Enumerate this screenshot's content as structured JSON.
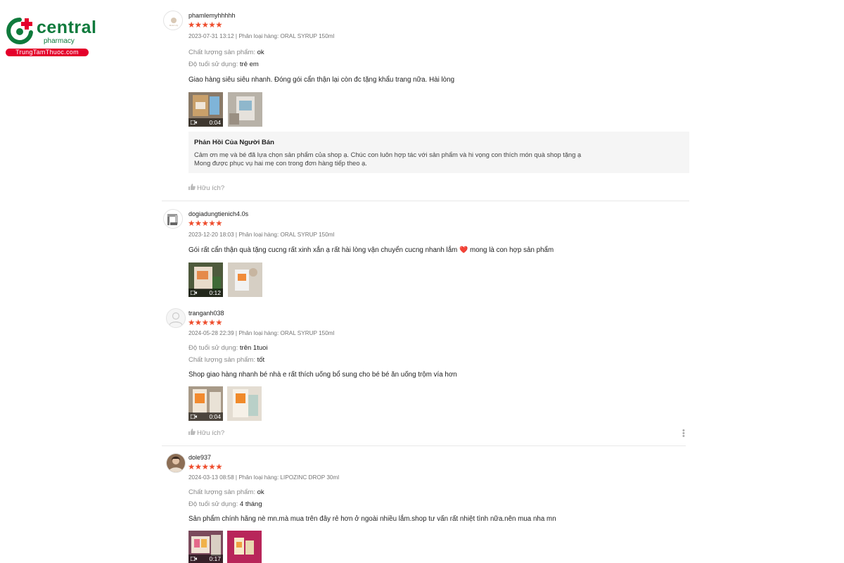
{
  "brand": {
    "name": "central",
    "sub": "pharmacy",
    "site": "TrungTamThuoc.com",
    "colors": {
      "green": "#0f7a3c",
      "red": "#e4002b"
    }
  },
  "stars_glyph": "★★★★★",
  "reviews": [
    {
      "username": "phamlemyhhhhh",
      "rating": 5,
      "meta": "2023-07-31 13:12 | Phân loại hàng: ORAL SYRUP 150ml",
      "attributes": [
        {
          "key": "Chất lượng sản phẩm:",
          "value": "ok"
        },
        {
          "key": "Độ tuổi sử dụng:",
          "value": "trẻ em"
        }
      ],
      "text": "Giao hàng siêu siêu nhanh. Đóng gói cẩn thận lại còn đc tặng khẩu trang nữa. Hài lòng",
      "media": [
        {
          "type": "video",
          "duration": "0:04"
        },
        {
          "type": "image"
        }
      ],
      "seller_reply": {
        "title": "Phản Hồi Của Người Bán",
        "lines": [
          "Cảm ơn mẹ và bé đã lựa chọn sản phẩm của shop ạ. Chúc con luôn hợp tác với sản phẩm và hi vọng con thích món quà shop tặng ạ",
          "Mong được phục vụ hai mẹ con trong đơn hàng tiếp theo ạ."
        ]
      },
      "helpful": "Hữu ích?"
    },
    {
      "username": "dogiadungtienich4.0s",
      "rating": 5,
      "meta": "2023-12-20 18:03 | Phân loại hàng: ORAL SYRUP 150ml",
      "text_before": "Gói rất cẩn thận quà tặng cucng rất xinh xắn ạ rất hài lòng vận chuyển cucng nhanh lắm",
      "text_emoji": "❤️",
      "text_after": "mong là con hợp sản phẩm",
      "media": [
        {
          "type": "video",
          "duration": "0:12"
        },
        {
          "type": "image"
        }
      ]
    },
    {
      "username": "tranganh038",
      "rating": 5,
      "meta": "2024-05-28 22:39 | Phân loại hàng: ORAL SYRUP 150ml",
      "attributes": [
        {
          "key": "Độ tuổi sử dụng:",
          "value": "trên 1tuoi"
        },
        {
          "key": "Chất lượng sản phẩm:",
          "value": "tốt"
        }
      ],
      "text": "Shop giao hàng nhanh bé nhà e rất thích uống bổ sung cho bé bé ăn uống trộm vía hơn",
      "media": [
        {
          "type": "video",
          "duration": "0:04"
        },
        {
          "type": "image"
        }
      ],
      "helpful": "Hữu ích?"
    },
    {
      "username": "dole937",
      "rating": 5,
      "meta": "2024-03-13 08:58 | Phân loại hàng: LIPOZINC DROP 30ml",
      "attributes": [
        {
          "key": "Chất lượng sản phẩm:",
          "value": "ok"
        },
        {
          "key": "Độ tuổi sử dụng:",
          "value": "4 tháng"
        }
      ],
      "text": "Sản phẩm chính hãng nè mn.mà mua trên đây rẻ hơn ở ngoài nhiều lắm.shop tư vấn rất nhiệt tình nữa.nên mua nha mn",
      "media": [
        {
          "type": "video",
          "duration": "0:17"
        },
        {
          "type": "image"
        }
      ]
    }
  ]
}
